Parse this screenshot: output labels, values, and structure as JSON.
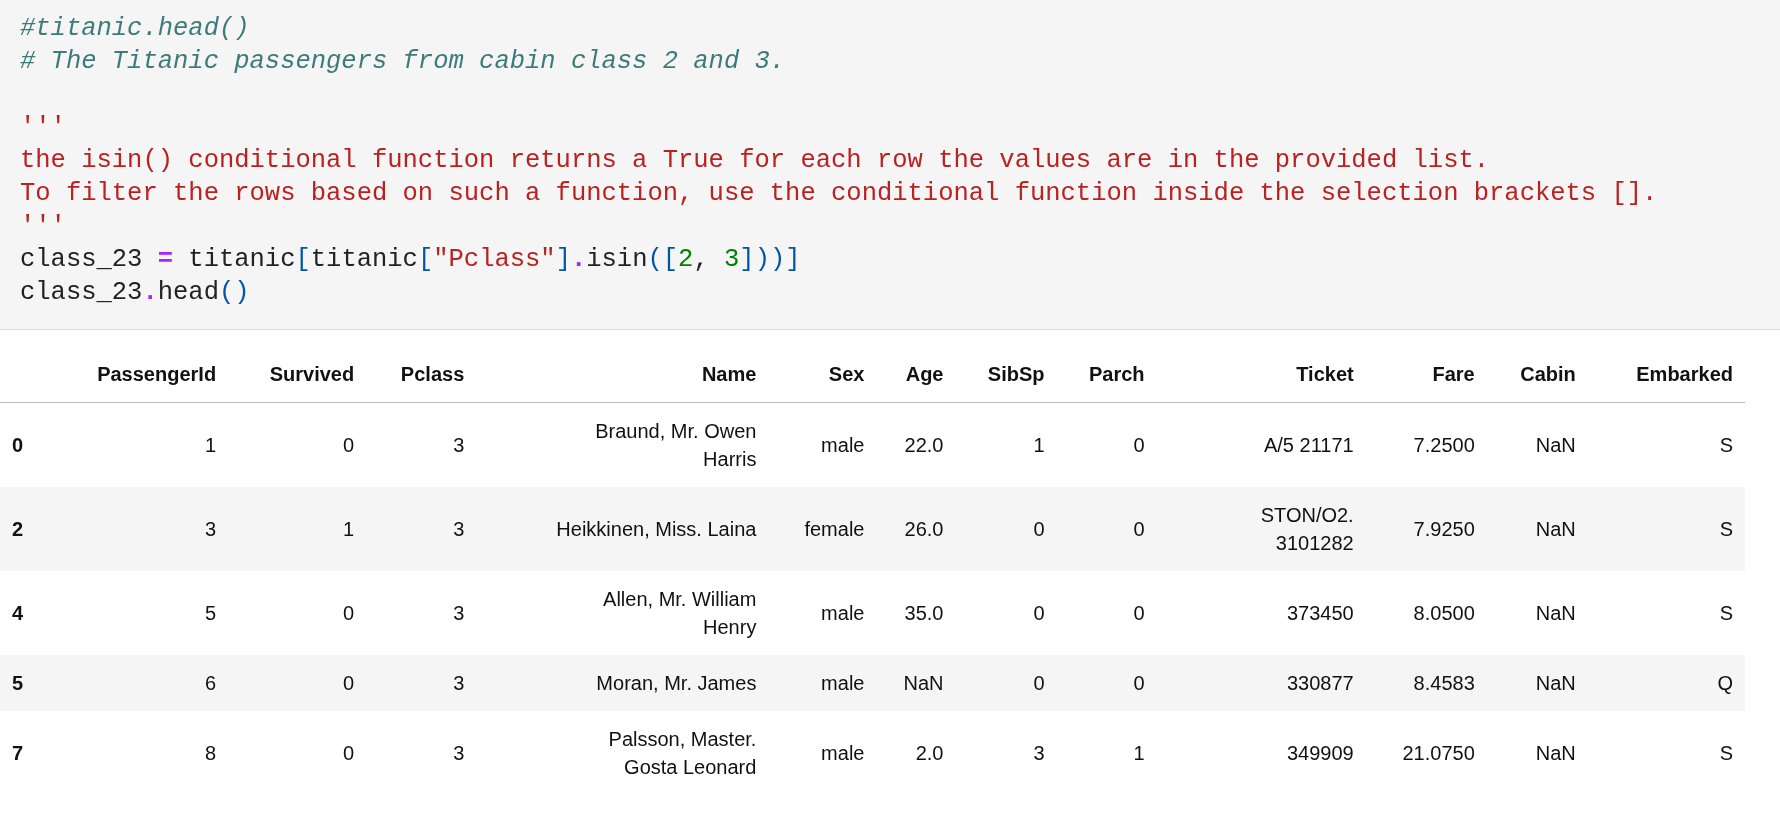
{
  "code_cell": {
    "groups": [
      {
        "lines": [
          {
            "tokens": [
              {
                "text": "#titanic.head()",
                "kind": "comment"
              }
            ]
          },
          {
            "tokens": [
              {
                "text": "# The Titanic passengers from cabin class 2 and 3.",
                "kind": "comment"
              }
            ]
          }
        ]
      },
      {
        "lines": [
          {
            "tokens": [
              {
                "text": "'''",
                "kind": "string"
              }
            ]
          },
          {
            "tokens": [
              {
                "text": "the isin() conditional function returns a True for each row the values are in the provided list.",
                "kind": "string"
              }
            ]
          },
          {
            "tokens": [
              {
                "text": "To filter the rows based on such a function, use the conditional function inside the selection brackets [].",
                "kind": "string"
              }
            ]
          },
          {
            "tokens": [
              {
                "text": "'''",
                "kind": "string"
              }
            ]
          },
          {
            "tokens": [
              {
                "text": "class_23 ",
                "kind": "name"
              },
              {
                "text": "=",
                "kind": "operator"
              },
              {
                "text": " titanic",
                "kind": "name"
              },
              {
                "text": "[",
                "kind": "bracket"
              },
              {
                "text": "titanic",
                "kind": "name"
              },
              {
                "text": "[",
                "kind": "bracket"
              },
              {
                "text": "\"Pclass\"",
                "kind": "string"
              },
              {
                "text": "]",
                "kind": "bracket"
              },
              {
                "text": ".",
                "kind": "operator"
              },
              {
                "text": "isin",
                "kind": "name"
              },
              {
                "text": "([",
                "kind": "bracket"
              },
              {
                "text": "2",
                "kind": "number"
              },
              {
                "text": ", ",
                "kind": "name"
              },
              {
                "text": "3",
                "kind": "number"
              },
              {
                "text": "]))",
                "kind": "bracket"
              },
              {
                "text": "]",
                "kind": "bracket"
              }
            ]
          },
          {
            "tokens": [
              {
                "text": "class_23",
                "kind": "name"
              },
              {
                "text": ".",
                "kind": "operator"
              },
              {
                "text": "head",
                "kind": "name"
              },
              {
                "text": "()",
                "kind": "bracket"
              }
            ]
          }
        ]
      }
    ]
  },
  "output_table": {
    "columns": [
      "PassengerId",
      "Survived",
      "Pclass",
      "Name",
      "Sex",
      "Age",
      "SibSp",
      "Parch",
      "Ticket",
      "Fare",
      "Cabin",
      "Embarked"
    ],
    "rows": [
      {
        "index": "0",
        "cells": [
          "1",
          "0",
          "3",
          "Braund, Mr. Owen Harris",
          "male",
          "22.0",
          "1",
          "0",
          "A/5 21171",
          "7.2500",
          "NaN",
          "S"
        ]
      },
      {
        "index": "2",
        "cells": [
          "3",
          "1",
          "3",
          "Heikkinen, Miss. Laina",
          "female",
          "26.0",
          "0",
          "0",
          "STON/O2. 3101282",
          "7.9250",
          "NaN",
          "S"
        ]
      },
      {
        "index": "4",
        "cells": [
          "5",
          "0",
          "3",
          "Allen, Mr. William Henry",
          "male",
          "35.0",
          "0",
          "0",
          "373450",
          "8.0500",
          "NaN",
          "S"
        ]
      },
      {
        "index": "5",
        "cells": [
          "6",
          "0",
          "3",
          "Moran, Mr. James",
          "male",
          "NaN",
          "0",
          "0",
          "330877",
          "8.4583",
          "NaN",
          "Q"
        ]
      },
      {
        "index": "7",
        "cells": [
          "8",
          "0",
          "3",
          "Palsson, Master. Gosta Leonard",
          "male",
          "2.0",
          "3",
          "1",
          "349909",
          "21.0750",
          "NaN",
          "S"
        ]
      }
    ]
  }
}
